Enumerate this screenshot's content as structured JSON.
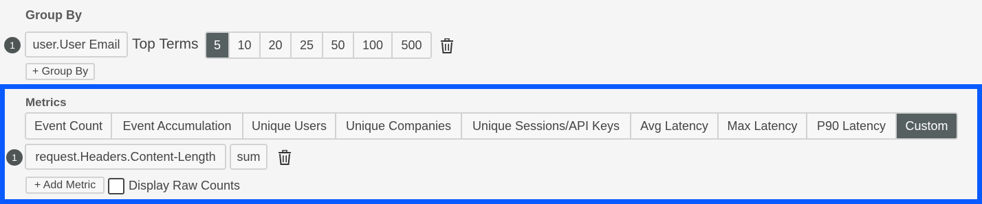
{
  "group_by": {
    "title": "Group By",
    "row_number": "1",
    "field": "user.User Email",
    "top_terms_label": "Top Terms",
    "top_terms": [
      {
        "label": "5",
        "active": true
      },
      {
        "label": "10",
        "active": false
      },
      {
        "label": "20",
        "active": false
      },
      {
        "label": "25",
        "active": false
      },
      {
        "label": "50",
        "active": false
      },
      {
        "label": "100",
        "active": false
      },
      {
        "label": "500",
        "active": false
      }
    ],
    "add_label": "+ Group By"
  },
  "metrics": {
    "title": "Metrics",
    "options": [
      {
        "label": "Event Count",
        "active": false
      },
      {
        "label": "Event Accumulation",
        "active": false
      },
      {
        "label": "Unique Users",
        "active": false
      },
      {
        "label": "Unique Companies",
        "active": false
      },
      {
        "label": "Unique Sessions/API Keys",
        "active": false
      },
      {
        "label": "Avg Latency",
        "active": false
      },
      {
        "label": "Max Latency",
        "active": false
      },
      {
        "label": "P90 Latency",
        "active": false
      },
      {
        "label": "Custom",
        "active": true
      }
    ],
    "row_number": "1",
    "field": "request.Headers.Content-Length",
    "aggregation": "sum",
    "add_label": "+ Add Metric",
    "display_raw_counts_label": "Display Raw Counts",
    "display_raw_counts_checked": false
  },
  "colors": {
    "active_segment": "#566060",
    "highlight_frame": "#0a5bff",
    "badge": "#4f5555"
  }
}
